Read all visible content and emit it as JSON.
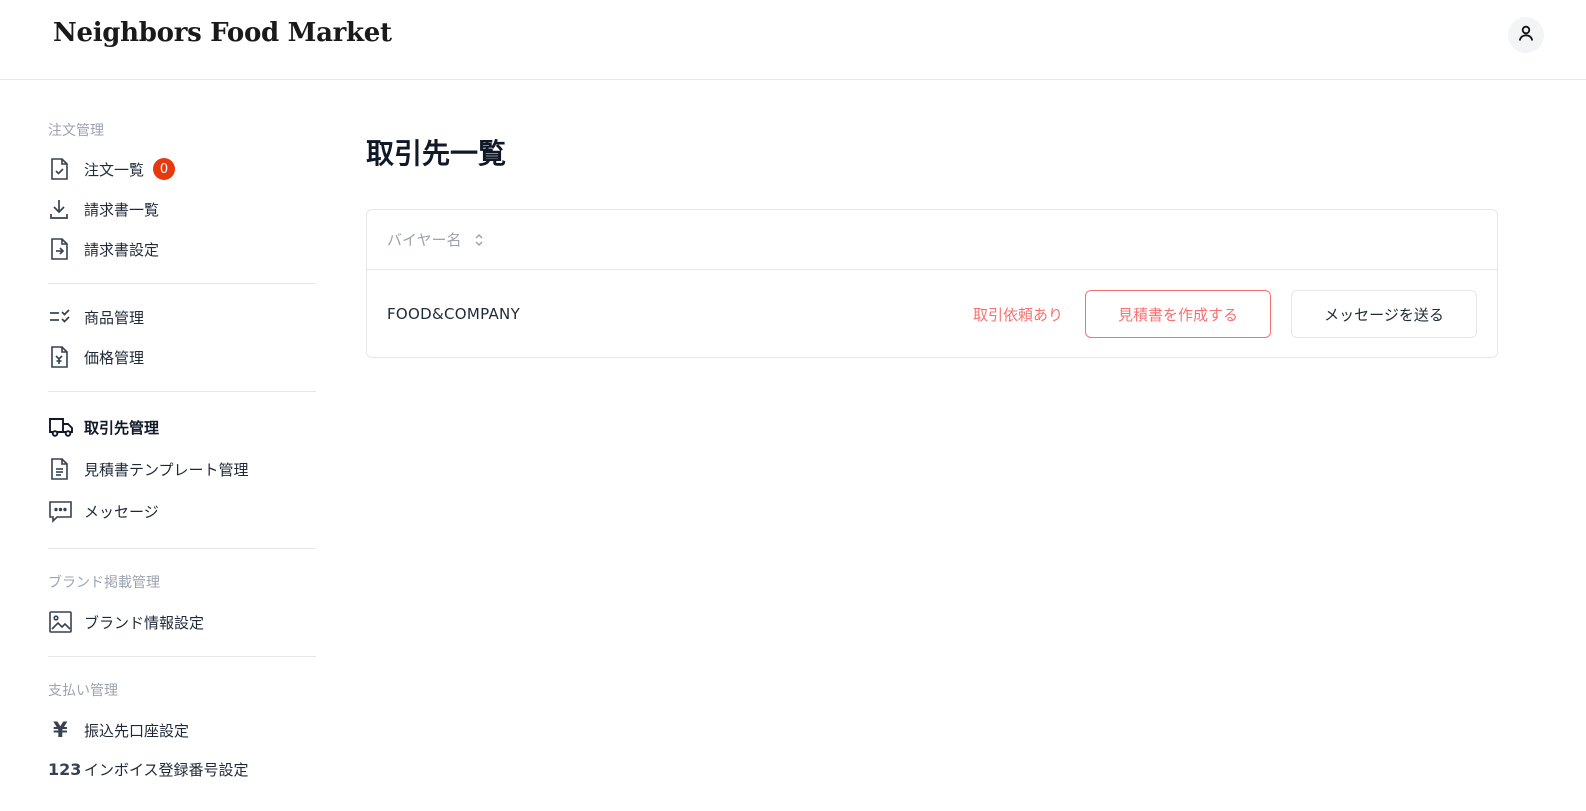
{
  "header": {
    "logo": "Neighbors Food Market",
    "account_icon": "user-icon"
  },
  "sidebar": {
    "sections": {
      "order": "注文管理",
      "brand": "ブランド掲載管理",
      "payment": "支払い管理"
    },
    "items": [
      {
        "label": "注文一覧",
        "icon": "file-check-icon",
        "badge": "0"
      },
      {
        "label": "請求書一覧",
        "icon": "download-icon"
      },
      {
        "label": "請求書設定",
        "icon": "file-arrow-icon"
      },
      {
        "label": "商品管理",
        "icon": "list-check-icon"
      },
      {
        "label": "価格管理",
        "icon": "file-yen-icon"
      },
      {
        "label": "取引先管理",
        "icon": "truck-icon",
        "active": true
      },
      {
        "label": "見積書テンプレート管理",
        "icon": "document-icon"
      },
      {
        "label": "メッセージ",
        "icon": "message-icon"
      },
      {
        "label": "ブランド情報設定",
        "icon": "image-icon"
      },
      {
        "label": "振込先口座設定",
        "icon": "yen-icon",
        "glyph": "¥"
      },
      {
        "label": "インボイス登録番号設定",
        "icon": "number-icon",
        "glyph": "123"
      }
    ]
  },
  "main": {
    "title": "取引先一覧",
    "table": {
      "column_header": "バイヤー名",
      "rows": [
        {
          "buyer": "FOOD&COMPANY",
          "status": "取引依頼あり",
          "quote_button": "見積書を作成する",
          "message_button": "メッセージを送る"
        }
      ]
    }
  },
  "colors": {
    "accent_red": "#f87171",
    "badge_red": "#e8390e",
    "muted_text": "#9ca3af",
    "border": "#e5e7eb"
  }
}
